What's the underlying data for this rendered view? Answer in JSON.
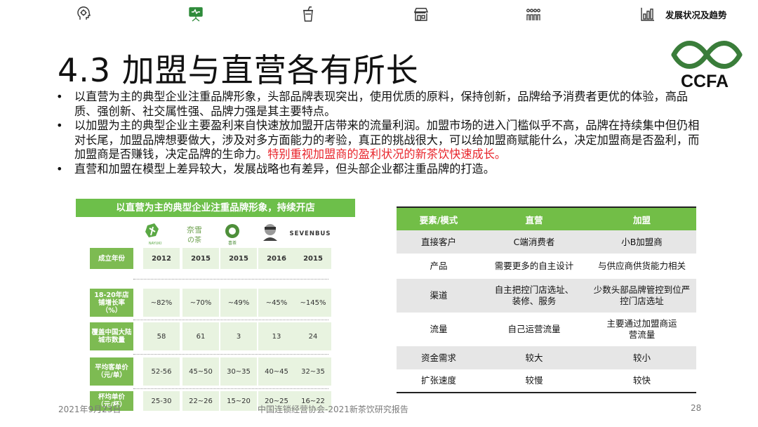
{
  "nav": {
    "icons": [
      "head-gear-icon",
      "presentation-board-icon",
      "drink-cup-icon",
      "storefront-icon",
      "people-group-icon",
      "bar-chart-icon"
    ],
    "active_index": 1,
    "section_label": "发展状况及趋势",
    "active_color": "#2e8b3a"
  },
  "title": "4.3 加盟与直营各有所长",
  "logo": {
    "text": "CCFA",
    "color": "#3a7d3a"
  },
  "bullets": [
    {
      "text": "以直营为主的典型企业注重品牌形象，头部品牌表现突出，使用优质的原料，保持创新，品牌给予消费者更优的体验，高品质、强创新、社交属性强、品牌力强是其主要特点。",
      "highlight": ""
    },
    {
      "text": "以加盟为主的典型企业主要盈利来自快速放加盟开店带来的流量利润。加盟市场的进入门槛似乎不高，品牌在持续集中但仍相对长尾，加盟品牌想要做大，涉及对多方面能力的考验，真正的挑战很大，可以给加盟商赋能什么，决定加盟商是否盈利，而加盟商是否赚钱，决定品牌的生命力。",
      "highlight": "特别重视加盟商的盈利状况的新茶饮快速成长。"
    },
    {
      "text": "直营和加盟在模型上差异较大，发展战略也有差异，但头部企业都注重品牌的打造。",
      "highlight": ""
    }
  ],
  "left_table": {
    "banner": "以直营为主的典型企业注重品牌形象，持续开店",
    "banner_color": "#6dbf4a",
    "brands": [
      {
        "logo_text": "NAYUKI 奈雪",
        "icon": "nayuki-logo-icon"
      },
      {
        "logo_text": "奈雪の茶",
        "icon": "naixue-tea-logo-icon"
      },
      {
        "logo_text": "喜茶",
        "icon": "heytea-circle-logo-icon"
      },
      {
        "logo_text": "LELECHA",
        "icon": "lelecha-logo-icon"
      },
      {
        "logo_text": "SEVENBUS",
        "icon": ""
      }
    ],
    "rows": [
      {
        "label": "成立年份",
        "values": [
          "2012",
          "2015",
          "2015",
          "2016",
          "2015"
        ],
        "bold": true
      },
      {
        "label": "18-20年店铺增长率（%）",
        "values": [
          "~82%",
          "~70%",
          "~49%",
          "~45%",
          "~145%"
        ],
        "bold": false
      },
      {
        "label": "覆盖中国大陆城市数量",
        "values": [
          "58",
          "61",
          "3",
          "13",
          "24"
        ],
        "bold": false
      },
      {
        "label": "平均客单价（元/单）",
        "values": [
          "52-56",
          "45~50",
          "30~35",
          "40~45",
          "32~35"
        ],
        "bold": false
      },
      {
        "label": "杯均单价（元/杯）",
        "values": [
          "25-30",
          "22~26",
          "15~20",
          "20~25",
          "16~22"
        ],
        "bold": false
      }
    ]
  },
  "right_table": {
    "headers": [
      "要素/模式",
      "直营",
      "加盟"
    ],
    "header_color": "#72be47",
    "rows": [
      [
        "直接客户",
        "C端消费者",
        "小B加盟商"
      ],
      [
        "产品",
        "需要更多的自主设计",
        "与供应商供货能力相关"
      ],
      [
        "渠道",
        "自主把控门店选址、装修、服务",
        "少数头部品牌管控到位严控门店选址"
      ],
      [
        "流量",
        "自己运营流量",
        "主要通过加盟商运营流量"
      ],
      [
        "资金需求",
        "较大",
        "较小"
      ],
      [
        "扩张速度",
        "较慢",
        "较快"
      ]
    ]
  },
  "footer": {
    "date": "2021年9月23日",
    "source": "中国连锁经营协会-2021新茶饮研究报告",
    "page": "28"
  }
}
